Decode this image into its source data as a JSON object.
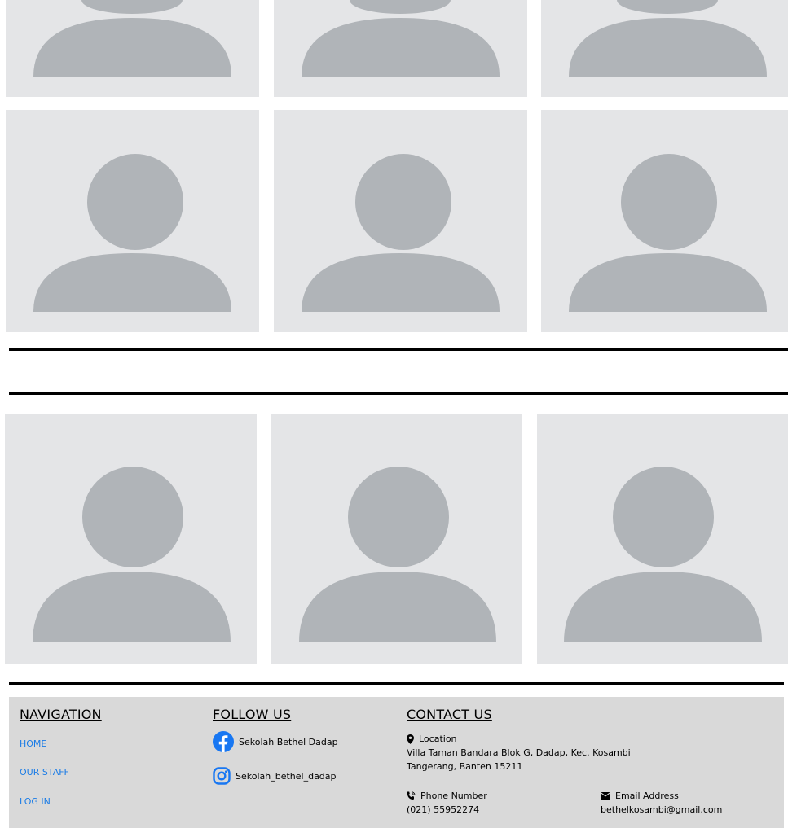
{
  "colors": {
    "card_bg": "#e4e5e7",
    "avatar_fill": "#b0b4b8",
    "footer_bg": "#d9d9d9",
    "link": "#1b7ce6",
    "facebook": "#1877f2"
  },
  "staff_grid": {
    "avatar_icon": "person-placeholder-icon",
    "count": 9
  },
  "footer": {
    "navigation": {
      "title": "NAVIGATION",
      "links": [
        "HOME",
        "OUR STAFF",
        "LOG IN"
      ]
    },
    "follow": {
      "title": "FOLLOW US",
      "facebook_label": "Sekolah Bethel Dadap",
      "instagram_label": "Sekolah_bethel_dadap"
    },
    "contact": {
      "title": "CONTACT US",
      "location_label": "Location",
      "address_line1": "Villa Taman Bandara Blok G, Dadap, Kec. Kosambi",
      "address_line2": "Tangerang, Banten 15211",
      "phone_label": "Phone Number",
      "phone_value": "(021) 55952274",
      "email_label": "Email Address",
      "email_value": "bethelkosambi@gmail.com"
    }
  }
}
